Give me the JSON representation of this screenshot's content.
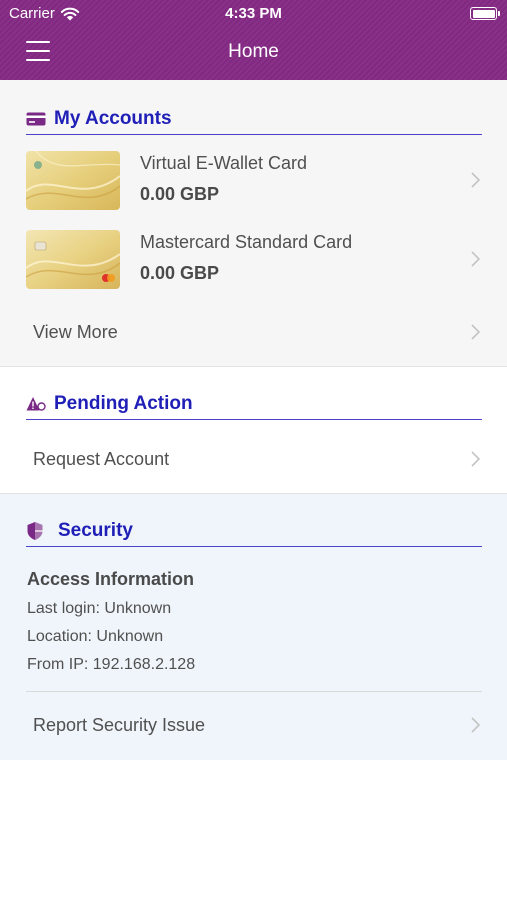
{
  "status_bar": {
    "carrier": "Carrier",
    "time": "4:33 PM"
  },
  "nav": {
    "title": "Home"
  },
  "accounts": {
    "title": "My Accounts",
    "cards": [
      {
        "name": "Virtual E-Wallet Card",
        "balance": "0.00 GBP"
      },
      {
        "name": "Mastercard Standard Card",
        "balance": "0.00 GBP"
      }
    ],
    "view_more": "View More"
  },
  "pending": {
    "title": "Pending Action",
    "request_account": "Request Account"
  },
  "security": {
    "title": "Security",
    "access_title": "Access Information",
    "last_login": "Last login: Unknown",
    "location": "Location: Unknown",
    "from_ip": "From IP: 192.168.2.128",
    "report": "Report Security Issue"
  },
  "colors": {
    "header": "#852a85",
    "accent": "#1f1fb8",
    "section_rule": "#4a43c9",
    "security_bg": "#eff5fa"
  },
  "icons": [
    "wifi-icon",
    "battery-icon",
    "menu-icon",
    "card-icon",
    "warning-icon",
    "shield-icon",
    "chevron-right-icon"
  ]
}
